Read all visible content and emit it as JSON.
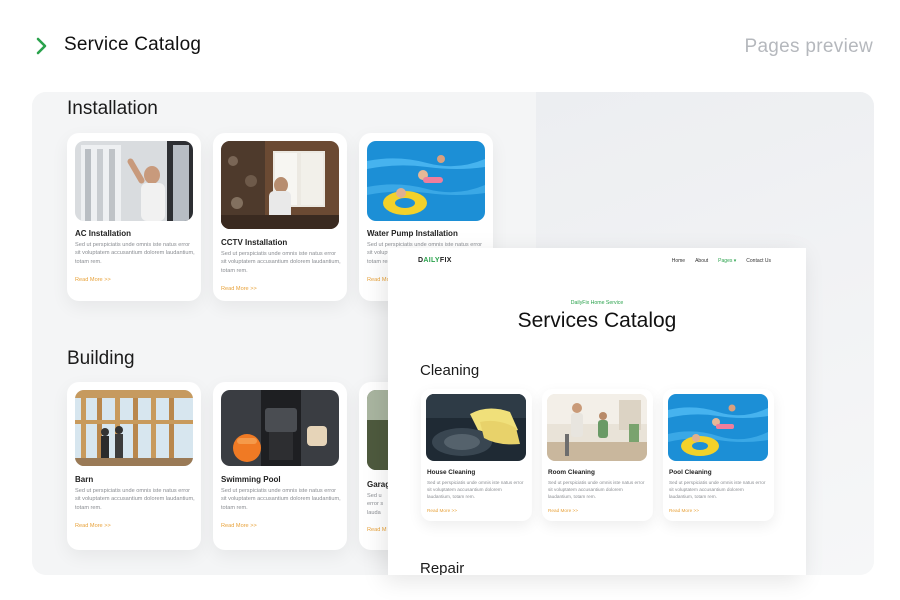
{
  "header": {
    "title": "Service Catalog",
    "preview_label": "Pages preview"
  },
  "installation": {
    "heading": "Installation",
    "cards": [
      {
        "title": "AC Installation",
        "desc": "Sed ut perspiciatis unde omnis iste natus error sit voluptatem accusantium dolorem laudantium, totam rem.",
        "more": "Read More >>"
      },
      {
        "title": "CCTV Installation",
        "desc": "Sed ut perspiciatis unde omnis iste natus error sit voluptatem accusantium dolorem laudantium, totam rem.",
        "more": "Read More >>"
      },
      {
        "title": "Water Pump Installation",
        "desc": "Sed ut perspiciatis unde omnis iste natus error sit voluptatem accusantium dolorem laudantium, totam rem.",
        "more": "Read More >>"
      }
    ]
  },
  "building": {
    "heading": "Building",
    "cards": [
      {
        "title": "Barn",
        "desc": "Sed ut perspiciatis unde omnis iste natus error sit voluptatem accusantium dolorem laudantium, totam rem.",
        "more": "Read More >>"
      },
      {
        "title": "Swimming Pool",
        "desc": "Sed ut perspiciatis unde omnis iste natus error sit voluptatem accusantium dolorem laudantium, totam rem.",
        "more": "Read More >>"
      },
      {
        "title": "Garag",
        "desc": "Sed u error s lauda",
        "more": "Read M"
      }
    ]
  },
  "preview": {
    "logo_first": "D",
    "logo_mid": "AILY",
    "logo_last": "FIX",
    "nav": {
      "home": "Home",
      "about": "About",
      "pages": "Pages",
      "pages_caret": "▾",
      "contact": "Contact Us"
    },
    "eyebrow": "DailyFix Home Service",
    "hero": "Services Catalog",
    "cleaning": {
      "heading": "Cleaning",
      "cards": [
        {
          "title": "House Cleaning",
          "desc": "Sed ut perspiciatis unde omnis iste natus error sit voluptatem accusantium dolorem laudantium, totam rem.",
          "more": "Read More >>"
        },
        {
          "title": "Room Cleaning",
          "desc": "Sed ut perspiciatis unde omnis iste natus error sit voluptatem accusantium dolorem laudantium, totam rem.",
          "more": "Read More >>"
        },
        {
          "title": "Pool Cleaning",
          "desc": "Sed ut perspiciatis unde omnis iste natus error sit voluptatem accusantium dolorem laudantium, totam rem.",
          "more": "Read More >>"
        }
      ]
    },
    "repair_heading": "Repair"
  },
  "colors": {
    "accent_green": "#2aa24c",
    "read_more_orange": "#e8a23a",
    "muted_text": "#8a8d92"
  },
  "icons": {
    "header_chevron": "chevron-right-icon"
  }
}
